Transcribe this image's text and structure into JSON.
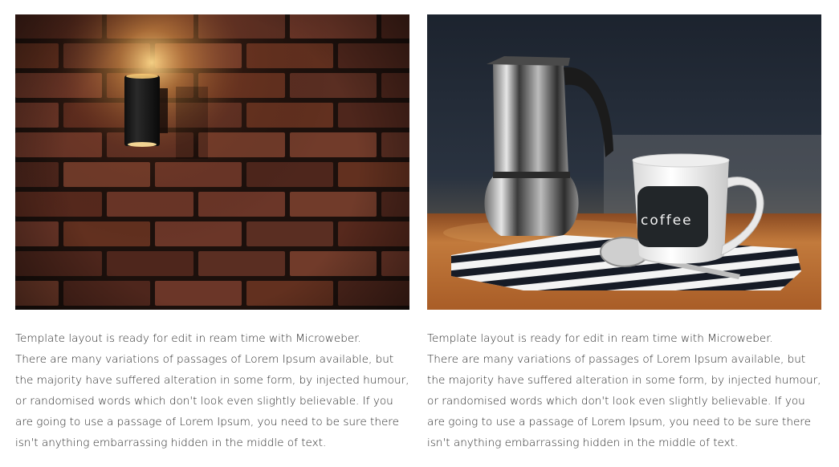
{
  "columns": [
    {
      "image": {
        "alt": "",
        "subject": "brick-wall-lamp"
      },
      "lines": [
        "Template layout is ready for edit in ream time with Microweber.",
        "There are many variations of passages of Lorem Ipsum available, but",
        "the majority have suffered alteration in some form, by injected humour,",
        "or randomised words which don't look even slightly believable. If you",
        "are going to use a passage of Lorem Ipsum, you need to be sure there",
        "isn't anything embarrassing hidden in the middle of text."
      ]
    },
    {
      "image": {
        "alt": "",
        "subject": "coffee-cup-moka-pot",
        "cup_text": "coffee"
      },
      "lines": [
        "Template layout is ready for edit in ream time with Microweber.",
        "There are many variations of passages of Lorem Ipsum available, but",
        "the majority have suffered alteration in some form, by injected humour,",
        "or randomised words which don't look even slightly believable. If you",
        "are going to use a passage of Lorem Ipsum, you need to be sure there",
        "isn't anything embarrassing hidden in the middle of text."
      ]
    }
  ],
  "colors": {
    "text": "#2a2a2a",
    "brick": "#5a2e22",
    "mortar": "#1c100c",
    "coffee_bg": "#1f2733",
    "wood": "#b5652c"
  }
}
